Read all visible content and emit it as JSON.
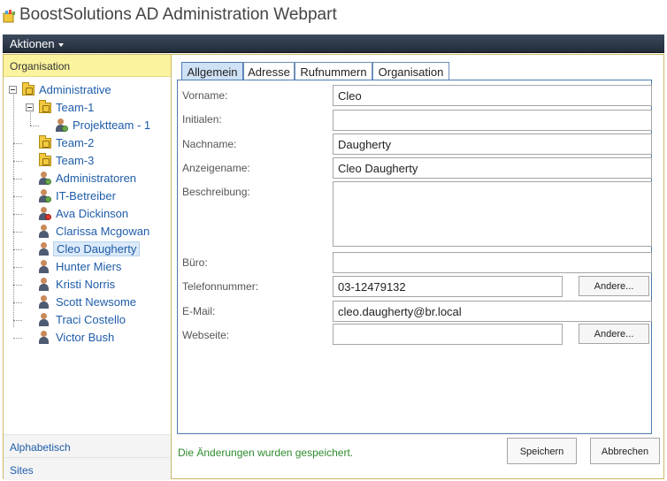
{
  "window": {
    "title": "BoostSolutions AD Administration Webpart"
  },
  "ribbon": {
    "actions_label": "Aktionen"
  },
  "left_panel": {
    "header": "Organisation",
    "tree": [
      {
        "label": "Administrative",
        "type": "folder"
      },
      {
        "label": "Team-1",
        "type": "folder"
      },
      {
        "label": "Projektteam - 1",
        "type": "group"
      },
      {
        "label": "Team-2",
        "type": "folder"
      },
      {
        "label": "Team-3",
        "type": "folder"
      },
      {
        "label": "Administratoren",
        "type": "group"
      },
      {
        "label": "IT-Betreiber",
        "type": "group"
      },
      {
        "label": "Ava Dickinson",
        "type": "user-disabled"
      },
      {
        "label": "Clarissa Mcgowan",
        "type": "user"
      },
      {
        "label": "Cleo Daugherty",
        "type": "user",
        "selected": true
      },
      {
        "label": "Hunter Miers",
        "type": "user"
      },
      {
        "label": "Kristi Norris",
        "type": "user"
      },
      {
        "label": "Scott Newsome",
        "type": "user"
      },
      {
        "label": "Traci Costello",
        "type": "user"
      },
      {
        "label": "Victor Bush",
        "type": "user"
      }
    ],
    "footer_links": [
      "Alphabetisch",
      "Sites"
    ]
  },
  "tabs": [
    {
      "label": "Allgemein",
      "active": true
    },
    {
      "label": "Adresse"
    },
    {
      "label": "Rufnummern"
    },
    {
      "label": "Organisation"
    }
  ],
  "form": {
    "vorname": {
      "label": "Vorname:",
      "value": "Cleo"
    },
    "initialen": {
      "label": "Initialen:",
      "value": ""
    },
    "nachname": {
      "label": "Nachname:",
      "value": "Daugherty"
    },
    "anzeigename": {
      "label": "Anzeigename:",
      "value": "Cleo Daugherty"
    },
    "beschreibung": {
      "label": "Beschreibung:",
      "value": ""
    },
    "buero": {
      "label": "Büro:",
      "value": ""
    },
    "telefon": {
      "label": "Telefonnummer:",
      "value": "03-12479132",
      "other_label": "Andere..."
    },
    "email": {
      "label": "E-Mail:",
      "value": "cleo.daugherty@br.local"
    },
    "webseite": {
      "label": "Webseite:",
      "value": "",
      "other_label": "Andere..."
    }
  },
  "status_message": "Die Änderungen wurden gespeichert.",
  "buttons": {
    "save": "Speichern",
    "cancel": "Abbrechen"
  },
  "colors": {
    "ribbon": "#2b3646",
    "header_yellow": "#fbf39d",
    "link_blue": "#1e5ca8",
    "status_green": "#2e8b2e",
    "active_tab": "#cfe1f5"
  }
}
